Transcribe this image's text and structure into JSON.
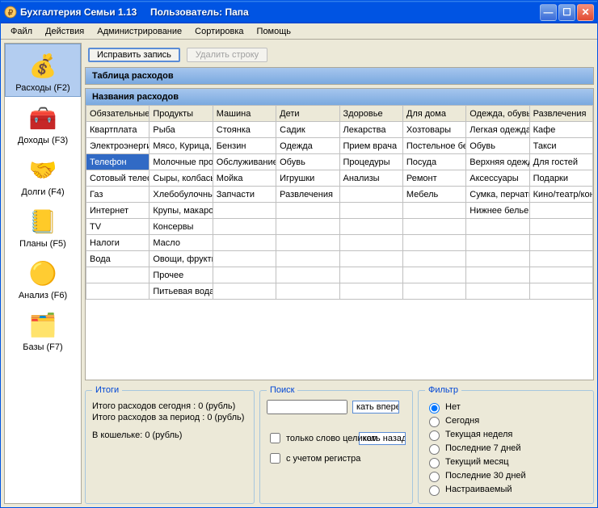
{
  "title": "Бухгалтерия Семьи 1.13     Пользователь: Папа",
  "menu": [
    "Файл",
    "Действия",
    "Администрирование",
    "Сортировка",
    "Помощь"
  ],
  "sidebar": [
    {
      "label": "Расходы (F2)",
      "icon": "💰",
      "sel": true
    },
    {
      "label": "Доходы (F3)",
      "icon": "🧰",
      "sel": false
    },
    {
      "label": "Долги (F4)",
      "icon": "🤝",
      "sel": false
    },
    {
      "label": "Планы (F5)",
      "icon": "📒",
      "sel": false
    },
    {
      "label": "Анализ (F6)",
      "icon": "🟡",
      "sel": false
    },
    {
      "label": "Базы (F7)",
      "icon": "🗂️",
      "sel": false
    }
  ],
  "toolbar": {
    "edit": "Исправить запись",
    "delete": "Удалить строку"
  },
  "panel1": "Таблица расходов",
  "panel2": "Названия расходов",
  "columns": [
    "Обязательные",
    "Продукты",
    "Машина",
    "Дети",
    "Здоровье",
    "Для дома",
    "Одежда, обувь",
    "Развлечения"
  ],
  "rows": [
    [
      "Квартплата",
      "Рыба",
      "Стоянка",
      "Садик",
      "Лекарства",
      "Хозтовары",
      "Легкая одежда",
      "Кафе"
    ],
    [
      "Электроэнергия",
      "Мясо, Курица,",
      "Бензин",
      "Одежда",
      "Прием врача",
      "Постельное белье",
      "Обувь",
      "Такси"
    ],
    [
      "Телефон",
      "Молочные продукты",
      "Обслуживание",
      "Обувь",
      "Процедуры",
      "Посуда",
      "Верхняя одежда",
      "Для гостей"
    ],
    [
      "Сотовый телефон",
      "Сыры, колбасы",
      "Мойка",
      "Игрушки",
      "Анализы",
      "Ремонт",
      "Аксессуары",
      "Подарки"
    ],
    [
      "Газ",
      "Хлебобулочные",
      "Запчасти",
      "Развлечения",
      "",
      "Мебель",
      "Сумка, перчатки",
      "Кино/театр/концерт"
    ],
    [
      "Интернет",
      "Крупы, макароны",
      "",
      "",
      "",
      "",
      "Нижнее белье",
      ""
    ],
    [
      "TV",
      "Консервы",
      "",
      "",
      "",
      "",
      "",
      ""
    ],
    [
      "Налоги",
      "Масло",
      "",
      "",
      "",
      "",
      "",
      ""
    ],
    [
      "Вода",
      "Овощи, фрукты",
      "",
      "",
      "",
      "",
      "",
      ""
    ],
    [
      "",
      "Прочее",
      "",
      "",
      "",
      "",
      "",
      ""
    ],
    [
      "",
      "Питьевая вода",
      "",
      "",
      "",
      "",
      "",
      ""
    ]
  ],
  "sel": {
    "r": 2,
    "c": 0
  },
  "totals": {
    "legend": "Итоги",
    "l1": "Итого расходов сегодня : 0 (рубль)",
    "l2": "Итого расходов за период : 0 (рубль)",
    "l3": "В кошельке: 0 (рубль)"
  },
  "search": {
    "legend": "Поиск",
    "fwd": "кать вперед",
    "back": "кать назад",
    "whole": "только слово целиком",
    "case": "с учетом регистра"
  },
  "filter": {
    "legend": "Фильтр",
    "opts": [
      "Нет",
      "Сегодня",
      "Текущая неделя",
      "Последние 7 дней",
      "Текущий месяц",
      "Последние 30 дней",
      "Настраиваемый"
    ],
    "sel": 0
  }
}
